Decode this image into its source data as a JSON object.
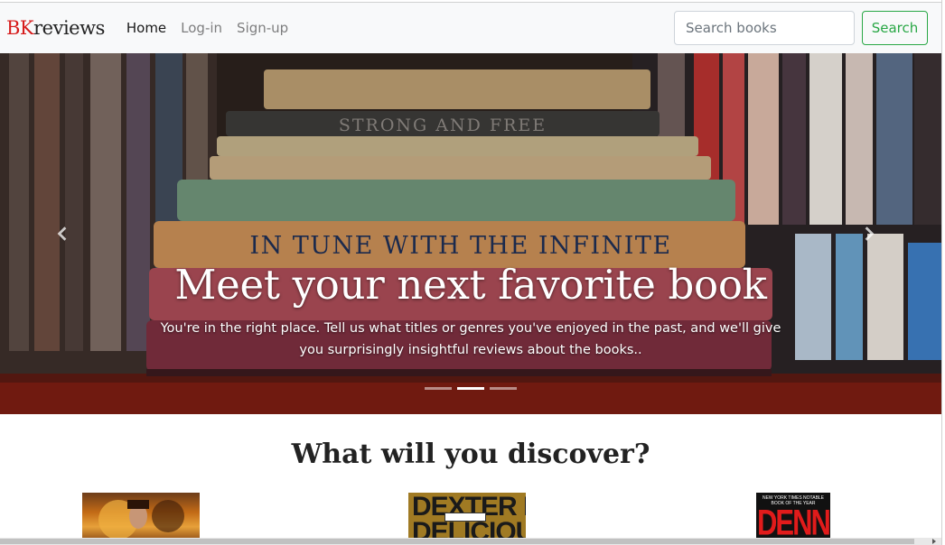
{
  "brand": {
    "part1": "BK",
    "part2": "reviews"
  },
  "nav": [
    {
      "label": "Home",
      "active": true
    },
    {
      "label": "Log-in",
      "active": false
    },
    {
      "label": "Sign-up",
      "active": false
    }
  ],
  "search": {
    "placeholder": "Search books",
    "button_label": "Search"
  },
  "carousel": {
    "heading": "Meet your next favorite book",
    "text": "You're in the right place. Tell us what titles or genres you've enjoyed in the past, and we'll give you surprisingly insightful reviews about the books..",
    "book_spine_1": "STRONG AND FREE",
    "book_spine_2": "IN TUNE WITH THE INFINITE",
    "slides": 3,
    "active_slide": 2
  },
  "discover": {
    "title": "What will you discover?",
    "covers": [
      {
        "name": "book-cover-1"
      },
      {
        "name": "book-cover-dexter",
        "text": "DEXTER IS DELICIOUS"
      },
      {
        "name": "book-cover-dennis",
        "top_text": "NEW YORK TIMES NOTABLE BOOK OF THE YEAR",
        "text": "DENNIS"
      }
    ]
  },
  "colors": {
    "brand_red": "#d61c1c",
    "search_green": "#28a745",
    "nav_bg": "#f8f9fa"
  }
}
